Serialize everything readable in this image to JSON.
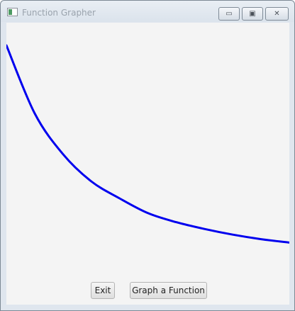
{
  "window": {
    "title": "Function Grapher",
    "app_icon": "application-icon",
    "controls": {
      "minimize_glyph": "▭",
      "maximize_glyph": "▣",
      "close_glyph": "✕"
    }
  },
  "buttons": {
    "exit_label": "Exit",
    "graph_label": "Graph a Function"
  },
  "colors": {
    "curve": "#0000ee",
    "canvas_background": "#f4f4f4"
  },
  "chart_data": {
    "type": "line",
    "title": "",
    "xlabel": "",
    "ylabel": "",
    "grid": false,
    "axes_visible": false,
    "x": [
      0.0,
      0.1,
      0.2,
      0.3,
      0.4,
      0.5,
      0.6,
      0.7,
      0.8,
      0.9,
      1.0
    ],
    "series": [
      {
        "values": [
          1.0,
          0.7,
          0.52,
          0.4,
          0.325,
          0.26,
          0.22,
          0.19,
          0.165,
          0.145,
          0.13
        ]
      }
    ],
    "ylim": [
      0,
      1
    ]
  }
}
